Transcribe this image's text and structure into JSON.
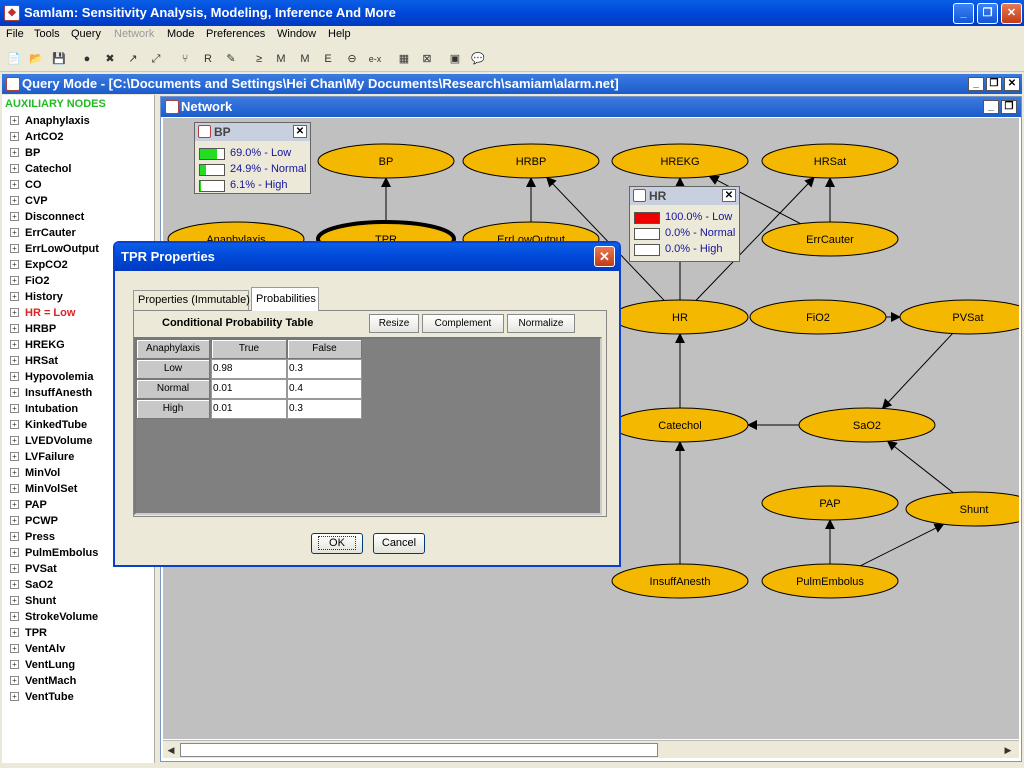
{
  "app": {
    "title": "Samlam: Sensitivity Analysis, Modeling, Inference And More"
  },
  "menu": [
    "File",
    "Tools",
    "Query",
    "Network",
    "Mode",
    "Preferences",
    "Window",
    "Help"
  ],
  "toolbar_icons": [
    "new-file-icon",
    "open-icon",
    "save-icon",
    "node-icon",
    "delete-node-icon",
    "edge-icon",
    "delete-edge-icon",
    "tree-icon",
    "rc-icon",
    "edit-icon",
    "geq-icon",
    "map-icon",
    "mpe-icon",
    "em-icon",
    "theta-icon",
    "e-x-icon",
    "table-icon",
    "delete-table-icon",
    "code-icon",
    "speech-icon"
  ],
  "toolbar_glyphs": [
    "📄",
    "📂",
    "💾",
    "●",
    "✖",
    "↗",
    "⤢",
    "⑂",
    "R",
    "✎",
    "≥",
    "M",
    "M",
    "E",
    "⊖",
    "e-x",
    "▦",
    "⊠",
    "▣",
    "💬"
  ],
  "query_window": {
    "title": "Query Mode - [C:\\Documents and Settings\\Hei Chan\\My Documents\\Research\\samiam\\alarm.net]"
  },
  "sidebar": {
    "header": "AUXILIARY NODES",
    "items": [
      "Anaphylaxis",
      "ArtCO2",
      "BP",
      "Catechol",
      "CO",
      "CVP",
      "Disconnect",
      "ErrCauter",
      "ErrLowOutput",
      "ExpCO2",
      "FiO2",
      "History",
      "HR = Low",
      "HRBP",
      "HREKG",
      "HRSat",
      "Hypovolemia",
      "InsuffAnesth",
      "Intubation",
      "KinkedTube",
      "LVEDVolume",
      "LVFailure",
      "MinVol",
      "MinVolSet",
      "PAP",
      "PCWP",
      "Press",
      "PulmEmbolus",
      "PVSat",
      "SaO2",
      "Shunt",
      "StrokeVolume",
      "TPR",
      "VentAlv",
      "VentLung",
      "VentMach",
      "VentTube"
    ],
    "highlighted": "HR = Low"
  },
  "network": {
    "title": "Network",
    "nodes": [
      "BP",
      "HRBP",
      "HREKG",
      "HRSat",
      "Anaphylaxis",
      "TPR",
      "ErrLowOutput",
      "ErrCauter",
      "HR",
      "FiO2",
      "PVSat",
      "Catechol",
      "SaO2",
      "PAP",
      "Shunt",
      "InsuffAnesth",
      "PulmEmbolus"
    ],
    "selected_node": "TPR",
    "node_color": "#F5B800"
  },
  "monitors": {
    "bp": {
      "title": "BP",
      "rows": [
        {
          "label": "69.0% - Low",
          "value": 0.69,
          "color": "#22DD22"
        },
        {
          "label": "24.9% - Normal",
          "value": 0.249,
          "color": "#22DD22"
        },
        {
          "label": "6.1% - High",
          "value": 0.061,
          "color": "#22DD22"
        }
      ]
    },
    "hr": {
      "title": "HR",
      "rows": [
        {
          "label": "100.0% - Low",
          "value": 1.0,
          "color": "#EE0000"
        },
        {
          "label": "0.0% - Normal",
          "value": 0.0,
          "color": "#EE0000"
        },
        {
          "label": "0.0% - High",
          "value": 0.0,
          "color": "#EE0000"
        }
      ]
    }
  },
  "dialog": {
    "title": "TPR Properties",
    "tabs": [
      "Properties (Immutable)",
      "Probabilities"
    ],
    "active_tab": "Probabilities",
    "cpt_title": "Conditional Probability Table",
    "buttons": [
      "Resize",
      "Complement",
      "Normalize"
    ],
    "table": {
      "headers": [
        "Anaphylaxis",
        "True",
        "False"
      ],
      "rows": [
        {
          "state": "Low",
          "true": "0.98",
          "false": "0.3"
        },
        {
          "state": "Normal",
          "true": "0.01",
          "false": "0.4"
        },
        {
          "state": "High",
          "true": "0.01",
          "false": "0.3"
        }
      ]
    },
    "ok": "OK",
    "cancel": "Cancel"
  }
}
